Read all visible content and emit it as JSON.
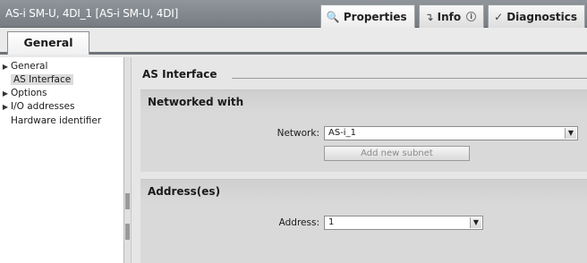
{
  "window": {
    "title": "AS-i SM-U, 4DI_1 [AS-i SM-U, 4DI]"
  },
  "inspector_tabs": [
    {
      "label": "Properties",
      "icon": "properties-icon",
      "active": true
    },
    {
      "label": "Info",
      "icon": "info-icon",
      "active": false
    },
    {
      "label": "Diagnostics",
      "icon": "diagnostics-icon",
      "active": false
    }
  ],
  "general_tab": {
    "label": "General"
  },
  "nav": {
    "items": [
      {
        "label": "General",
        "expandable": true,
        "selected": false
      },
      {
        "label": "AS Interface",
        "expandable": false,
        "selected": true
      },
      {
        "label": "Options",
        "expandable": true,
        "selected": false
      },
      {
        "label": "I/O addresses",
        "expandable": true,
        "selected": false
      },
      {
        "label": "Hardware identifier",
        "expandable": false,
        "selected": false
      }
    ]
  },
  "main": {
    "section_title": "AS Interface",
    "networked_with": {
      "title": "Networked with",
      "network_label": "Network:",
      "network_value": "AS-i_1",
      "add_subnet_label": "Add new subnet"
    },
    "addresses": {
      "title": "Address(es)",
      "address_label": "Address:",
      "address_value": "1"
    }
  }
}
